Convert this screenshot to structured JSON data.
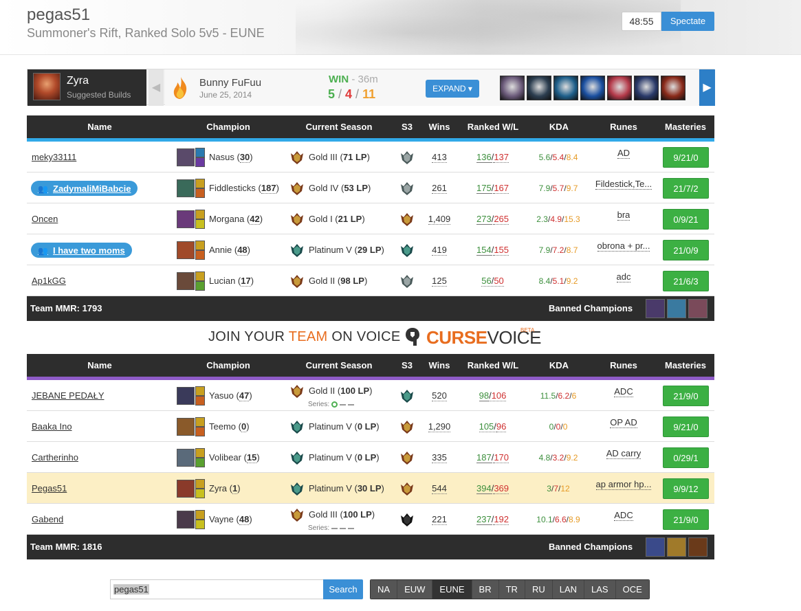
{
  "header": {
    "summoner": "pegas51",
    "subtitle": "Summoner's Rift, Ranked Solo 5v5 - EUNE",
    "timer": "48:55",
    "spectate_label": "Spectate"
  },
  "match_bar": {
    "champion": "Zyra",
    "champion_sub": "Suggested Builds",
    "opponent": "Bunny FuFuu",
    "date": "June 25, 2014",
    "result": "WIN",
    "length": "- 36m",
    "kills": "5",
    "deaths": "4",
    "assists": "11",
    "expand_label": "EXPAND",
    "item_colors": [
      "#6b5a7a",
      "#2c3e50",
      "#1e5f8a",
      "#1a4fa0",
      "#b43a4a",
      "#2a3a6a",
      "#8a2a1a"
    ]
  },
  "table_headers": {
    "name": "Name",
    "champion": "Champion",
    "season": "Current Season",
    "s3": "S3",
    "wins": "Wins",
    "ranked_wl": "Ranked W/L",
    "kda": "KDA",
    "runes": "Runes",
    "masteries": "Masteries"
  },
  "team_blue": {
    "accent": "#31a9e8",
    "mmr": "Team MMR: 1793",
    "banned_label": "Banned Champions",
    "ban_colors": [
      "#4a3a6a",
      "#3a7aa0",
      "#7a4a5a"
    ],
    "players": [
      {
        "name": "meky33111",
        "friend": false,
        "champ": "Nasus",
        "games": "30",
        "champ_color": "#5a4a6a",
        "spell1": "#2a7ab0",
        "spell2": "#6a3aa0",
        "rank": "Gold III",
        "lp": "71 LP",
        "tier": "gold",
        "s3": "silver",
        "wins": "413",
        "w": "136",
        "l": "137",
        "k": "5.6",
        "d": "5.4",
        "a": "8.4",
        "runes": "AD",
        "masteries": "9/21/0",
        "self": false
      },
      {
        "name": "ZadymaliMiBabcie",
        "friend": true,
        "champ": "Fiddlesticks",
        "games": "187",
        "champ_color": "#3a6a5a",
        "spell1": "#c8a020",
        "spell2": "#c86020",
        "rank": "Gold IV",
        "lp": "53 LP",
        "tier": "gold",
        "s3": "silver",
        "wins": "261",
        "w": "175",
        "l": "167",
        "k": "7.9",
        "d": "5.7",
        "a": "9.7",
        "runes": "Fildestick,Te...",
        "masteries": "21/7/2",
        "self": false
      },
      {
        "name": "Oncen",
        "friend": false,
        "champ": "Morgana",
        "games": "42",
        "champ_color": "#6a3a7a",
        "spell1": "#c8a020",
        "spell2": "#c8c020",
        "rank": "Gold I",
        "lp": "21 LP",
        "tier": "gold",
        "s3": "gold",
        "wins": "1,409",
        "w": "273",
        "l": "265",
        "k": "2.3",
        "d": "4.9",
        "a": "15.3",
        "runes": "bra",
        "masteries": "0/9/21",
        "self": false
      },
      {
        "name": "I have two moms",
        "friend": true,
        "champ": "Annie",
        "games": "48",
        "champ_color": "#a04a2a",
        "spell1": "#c8a020",
        "spell2": "#c86020",
        "rank": "Platinum V",
        "lp": "29 LP",
        "tier": "platinum",
        "s3": "platinum",
        "wins": "419",
        "w": "154",
        "l": "155",
        "k": "7.9",
        "d": "7.2",
        "a": "8.7",
        "runes": "obrona + pr...",
        "masteries": "21/0/9",
        "self": false
      },
      {
        "name": "Ap1kGG",
        "friend": false,
        "champ": "Lucian",
        "games": "17",
        "champ_color": "#6a4a3a",
        "spell1": "#c8a020",
        "spell2": "#5aa030",
        "rank": "Gold II",
        "lp": "98 LP",
        "tier": "gold",
        "s3": "silver",
        "wins": "125",
        "w": "56",
        "l": "50",
        "k": "8.4",
        "d": "5.1",
        "a": "9.2",
        "runes": "adc",
        "masteries": "21/6/3",
        "self": false
      }
    ]
  },
  "team_purple": {
    "accent": "#8e5bc8",
    "mmr": "Team MMR: 1816",
    "banned_label": "Banned Champions",
    "ban_colors": [
      "#3a4a8a",
      "#a07a2a",
      "#6a3a1a"
    ],
    "players": [
      {
        "name": "JEBANE PEDAŁY",
        "friend": false,
        "champ": "Yasuo",
        "games": "47",
        "champ_color": "#3a3a5a",
        "spell1": "#c8a020",
        "spell2": "#c86020",
        "rank": "Gold II",
        "lp": "100 LP",
        "tier": "gold",
        "s3": "platinum",
        "wins": "520",
        "w": "98",
        "l": "106",
        "k": "11.5",
        "d": "6.2",
        "a": "6",
        "runes": "ADC",
        "masteries": "21/9/0",
        "self": false,
        "series": "Series:",
        "series_marks": [
          "win",
          "none",
          "none"
        ]
      },
      {
        "name": "Baaka Ino",
        "friend": false,
        "champ": "Teemo",
        "games": "0",
        "champ_color": "#8a5a2a",
        "spell1": "#c8a020",
        "spell2": "#c86020",
        "rank": "Platinum V",
        "lp": "0 LP",
        "tier": "platinum",
        "s3": "gold",
        "wins": "1,290",
        "w": "105",
        "l": "96",
        "k": "0",
        "d": "0",
        "a": "0",
        "runes": "OP AD",
        "masteries": "9/21/0",
        "self": false
      },
      {
        "name": "Cartherinho",
        "friend": false,
        "champ": "Volibear",
        "games": "15",
        "champ_color": "#5a6a7a",
        "spell1": "#c8a020",
        "spell2": "#5aa030",
        "rank": "Platinum V",
        "lp": "0 LP",
        "tier": "platinum",
        "s3": "gold",
        "wins": "335",
        "w": "187",
        "l": "170",
        "k": "4.8",
        "d": "3.2",
        "a": "9.2",
        "runes": "AD carry",
        "masteries": "0/29/1",
        "self": false
      },
      {
        "name": "Pegas51",
        "friend": false,
        "champ": "Zyra",
        "games": "1",
        "champ_color": "#8a3a2a",
        "spell1": "#c8a020",
        "spell2": "#c8c020",
        "rank": "Platinum V",
        "lp": "30 LP",
        "tier": "platinum",
        "s3": "gold",
        "wins": "544",
        "w": "394",
        "l": "369",
        "k": "3",
        "d": "7",
        "a": "12",
        "runes": "ap armor hp...",
        "masteries": "9/9/12",
        "self": true
      },
      {
        "name": "Gabend",
        "friend": false,
        "champ": "Vayne",
        "games": "48",
        "champ_color": "#4a3a4a",
        "spell1": "#c8a020",
        "spell2": "#c8c020",
        "rank": "Gold III",
        "lp": "100 LP",
        "tier": "gold",
        "s3": "unranked",
        "wins": "221",
        "w": "237",
        "l": "192",
        "k": "10.1",
        "d": "6.6",
        "a": "8.9",
        "runes": "ADC",
        "masteries": "21/9/0",
        "self": false,
        "series": "Series:",
        "series_marks": [
          "none",
          "none",
          "none"
        ]
      }
    ]
  },
  "voice": {
    "join": "JOIN YOUR ",
    "team": "TEAM",
    "on_voice": " ON VOICE",
    "brand_curse": "CURSE",
    "brand_voice": "VOICE",
    "beta": "BETA"
  },
  "search": {
    "value": "pegas51",
    "button": "Search",
    "regions": [
      "NA",
      "EUW",
      "EUNE",
      "BR",
      "TR",
      "RU",
      "LAN",
      "LAS",
      "OCE"
    ],
    "active_region": "EUNE"
  }
}
